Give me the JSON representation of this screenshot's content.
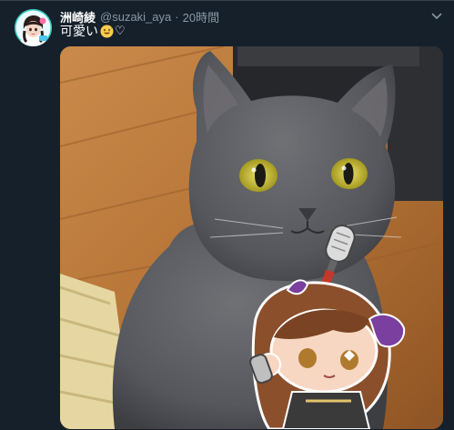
{
  "tweet": {
    "author_name": "洲崎綾",
    "author_handle": "@suzaki_aya",
    "separator": "·",
    "time": "20時間",
    "text": "可愛い",
    "heart": "♡",
    "emoji": "grinning-face-with-sweat-icon"
  },
  "icons": {
    "menu": "chevron-down-icon",
    "avatar": "anime-girl-avatar"
  },
  "colors": {
    "background": "#15202b",
    "secondary_text": "#8899a6",
    "primary_text": "#ffffff"
  }
}
